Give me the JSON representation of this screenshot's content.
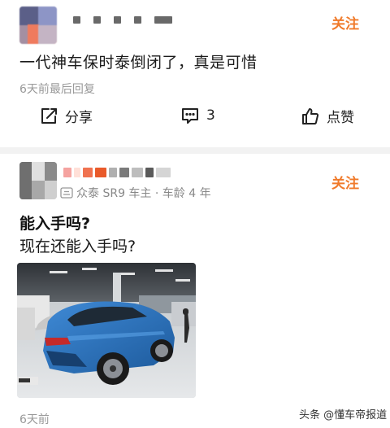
{
  "post1": {
    "follow_label": "关注",
    "content": "一代神车保时泰倒闭了，真是可惜",
    "meta": "6天前最后回复",
    "actions": {
      "share_label": "分享",
      "comment_count": "3",
      "like_label": "点赞"
    }
  },
  "post2": {
    "badge": "众泰 SR9 车主 · 车龄 4 年",
    "follow_label": "关注",
    "title": "能入手吗?",
    "body": "现在还能入手吗?",
    "meta": "6天前"
  },
  "watermark": "头条 @懂车帝报道",
  "colors": {
    "accent": "#f07a2a",
    "meta_gray": "#999999",
    "divider": "#f2f2f2",
    "car_blue": "#2f79c4"
  },
  "icons": {
    "share": "share-icon",
    "comment": "comment-icon",
    "like": "thumbs-up-icon",
    "car_owner": "car-owner-badge-icon"
  }
}
